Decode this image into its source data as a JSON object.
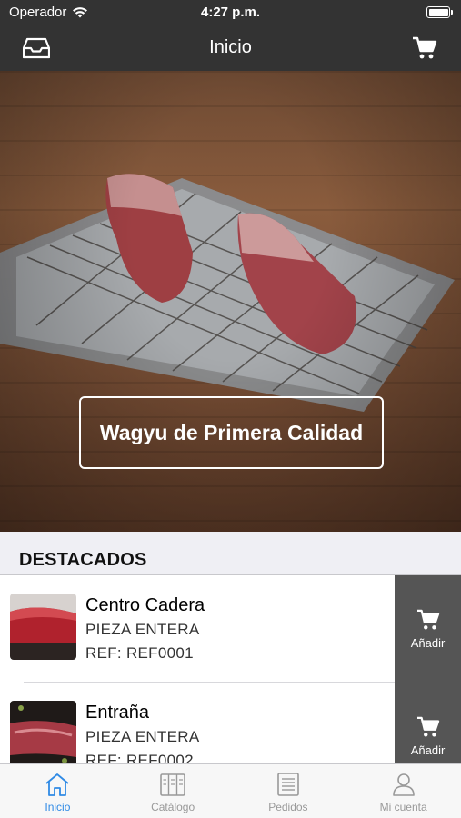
{
  "status_bar": {
    "carrier": "Operador",
    "time": "4:27 p.m."
  },
  "nav": {
    "title": "Inicio",
    "left_icon": "inbox-icon",
    "right_icon": "cart-icon"
  },
  "hero": {
    "banner_text": "Wagyu de Primera Calidad"
  },
  "featured": {
    "title": "DESTACADOS",
    "add_label": "Añadir",
    "products": [
      {
        "name": "Centro Cadera",
        "subtitle": "PIEZA ENTERA",
        "ref": "REF: REF0001"
      },
      {
        "name": "Entraña",
        "subtitle": "PIEZA ENTERA",
        "ref": "REF: REF0002"
      }
    ]
  },
  "tabs": [
    {
      "label": "Inicio",
      "icon": "home-icon",
      "active": true
    },
    {
      "label": "Catálogo",
      "icon": "catalog-icon",
      "active": false
    },
    {
      "label": "Pedidos",
      "icon": "orders-icon",
      "active": false
    },
    {
      "label": "Mi cuenta",
      "icon": "account-icon",
      "active": false
    }
  ],
  "colors": {
    "bar_background": "#333333",
    "tab_active": "#2f8ae5",
    "tab_inactive": "#999999",
    "add_action": "#555555"
  }
}
